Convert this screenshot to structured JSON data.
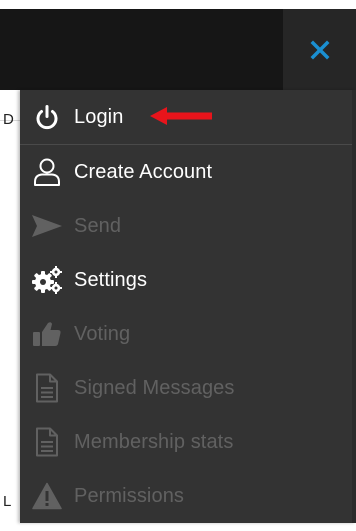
{
  "menu": {
    "items": [
      {
        "label": "Login",
        "icon": "power-icon",
        "enabled": true
      },
      {
        "label": "Create Account",
        "icon": "user-icon",
        "enabled": true
      },
      {
        "label": "Send",
        "icon": "send-icon",
        "enabled": false
      },
      {
        "label": "Settings",
        "icon": "gears-icon",
        "enabled": true
      },
      {
        "label": "Voting",
        "icon": "thumbs-up-icon",
        "enabled": false
      },
      {
        "label": "Signed Messages",
        "icon": "document-icon",
        "enabled": false
      },
      {
        "label": "Membership stats",
        "icon": "document-icon",
        "enabled": false
      },
      {
        "label": "Permissions",
        "icon": "warning-icon",
        "enabled": false
      }
    ]
  },
  "topbar": {
    "close_icon": "close-icon",
    "close_color": "#1a8fd1"
  },
  "colors": {
    "menu_background": "#333333",
    "enabled_text": "#ffffff",
    "disabled_text": "#616161",
    "arrow": "#e8141b"
  },
  "background": {
    "partial_glyphs": [
      "D",
      "L"
    ]
  }
}
